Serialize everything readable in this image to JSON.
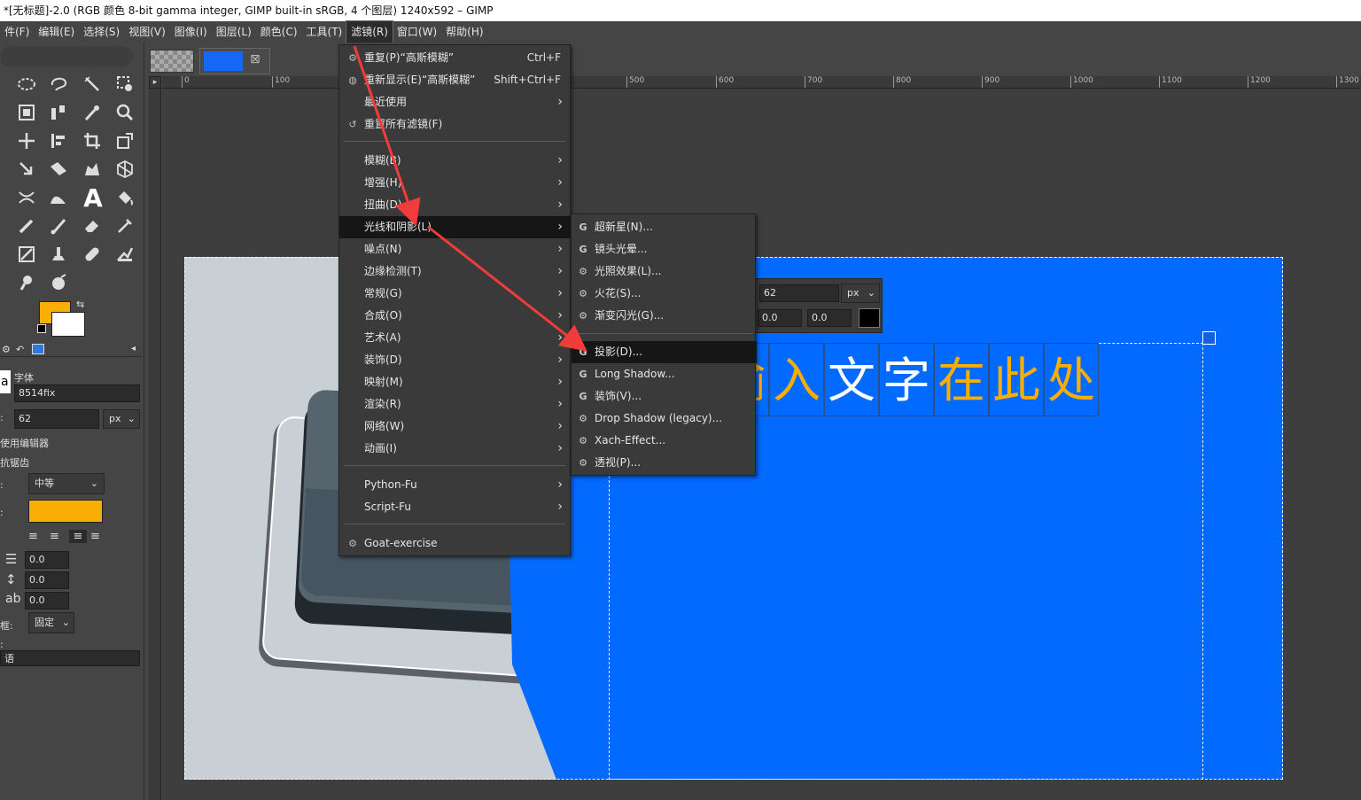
{
  "window": {
    "title": "*[无标题]-2.0 (RGB 颜色 8-bit gamma integer, GIMP built-in sRGB, 4 个图层) 1240x592 – GIMP"
  },
  "menubar": [
    {
      "label": "件(F)"
    },
    {
      "label": "编辑(E)"
    },
    {
      "label": "选择(S)"
    },
    {
      "label": "视图(V)"
    },
    {
      "label": "图像(I)"
    },
    {
      "label": "图层(L)"
    },
    {
      "label": "颜色(C)"
    },
    {
      "label": "工具(T)"
    },
    {
      "label": "滤镜(R)"
    },
    {
      "label": "窗口(W)"
    },
    {
      "label": "帮助(H)"
    }
  ],
  "filters_menu": {
    "repeat": {
      "label": "重复(P)“高斯模糊”",
      "shortcut": "Ctrl+F"
    },
    "reshow": {
      "label": "重新显示(E)“高斯模糊”",
      "shortcut": "Shift+Ctrl+F"
    },
    "recent": {
      "label": "最近使用"
    },
    "reset": {
      "label": "重置所有滤镜(F)"
    },
    "groups": [
      "模糊(B)",
      "增强(H)",
      "扭曲(D)",
      "光线和阴影(L)",
      "噪点(N)",
      "边缘检测(T)",
      "常规(G)",
      "合成(O)",
      "艺术(A)",
      "装饰(D)",
      "映射(M)",
      "渲染(R)",
      "网络(W)",
      "动画(I)"
    ],
    "scripts": [
      "Python-Fu",
      "Script-Fu"
    ],
    "goat": {
      "label": "Goat-exercise"
    }
  },
  "light_shadow_submenu": {
    "items": [
      "超新星(N)...",
      "镜头光晕...",
      "光照效果(L)...",
      "火花(S)...",
      "渐变闪光(G)..."
    ],
    "items2": [
      "投影(D)...",
      "Long Shadow...",
      "装饰(V)...",
      "Drop Shadow (legacy)...",
      "Xach-Effect...",
      "透视(P)..."
    ]
  },
  "tool_options": {
    "font_label": "字体",
    "font_value": "8514fix",
    "size_value": "62",
    "size_unit": "px",
    "use_editor": "使用编辑器",
    "antialias": "抗锯齿",
    "hinting_value": "中等",
    "indent_value": "0.0",
    "line_spacing_value": "0.0",
    "letter_spacing_value": "0.0",
    "box_label": "框:",
    "box_value": "固定",
    "lang_label": "语"
  },
  "text_toolbar": {
    "size": "62",
    "unit": "px",
    "baseline": "0.0",
    "kerning": "0.0"
  },
  "canvas_text": [
    "输",
    "入",
    "文",
    "字",
    "在",
    "此",
    "处"
  ],
  "ruler_labels": [
    "0",
    "100",
    "500",
    "600",
    "700",
    "800",
    "900",
    "1000",
    "1100",
    "1200",
    "1300"
  ],
  "colors": {
    "fg": "#f9ae06",
    "bg": "#ffffff",
    "canvas_blue": "#036aff",
    "highlight_text": "#f9ae06"
  }
}
